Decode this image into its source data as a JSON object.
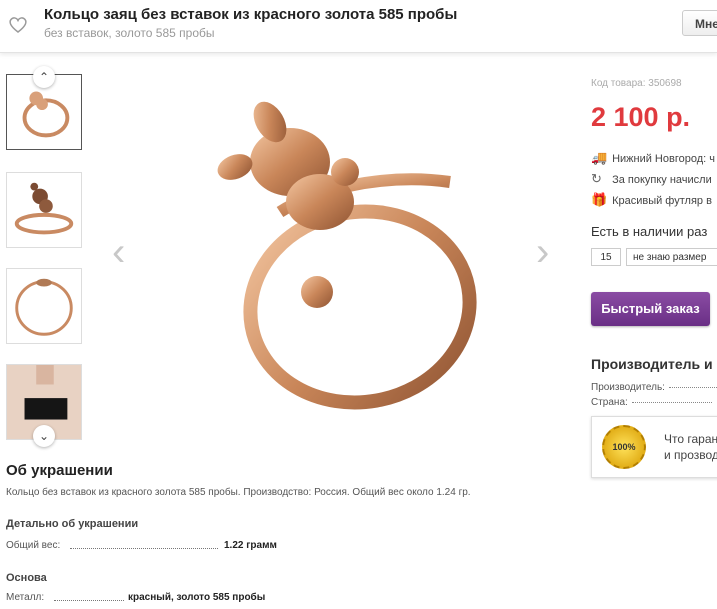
{
  "header": {
    "title": "Кольцо заяц без вставок из красного золота 585 пробы",
    "subtitle": "без вставок, золото 585 пробы",
    "button_label": "Мне",
    "heart_icon": "heart-icon"
  },
  "gallery": {
    "thumbnails": [
      "ring-front",
      "ring-side",
      "ring-top",
      "model-photo"
    ],
    "up_icon": "chevron-up-icon",
    "down_icon": "chevron-down-icon",
    "prev_icon": "chevron-left-icon",
    "next_icon": "chevron-right-icon"
  },
  "product": {
    "sku": "Код товара: 350698",
    "price": "2 100 р.",
    "price_color": "#e03a3e",
    "delivery": "Нижний Новгород: ч",
    "bonus": "За покупку начисли",
    "gift": "Красивый футляр в",
    "stock": "Есть в наличии раз",
    "qty": "15",
    "size_placeholder": "не знаю размер",
    "order_button": "Быстрый заказ",
    "order_color": "#7a3d95"
  },
  "manufacturer": {
    "heading": "Производитель и",
    "rows": [
      {
        "label": "Производитель:"
      },
      {
        "label": "Страна:"
      }
    ],
    "badge": "100%",
    "guarantee_line1": "Что гаран",
    "guarantee_line2": "и прозвод"
  },
  "about": {
    "heading": "Об украшении",
    "text": "Кольцо без вставок из красного золота 585 пробы. Производство: Россия. Общий вес около 1.24 гр.",
    "details_heading": "Детально об украшении",
    "weight_label": "Общий вес:",
    "weight_value": "1.22 грамм",
    "base_heading": "Основа",
    "metal_label": "Металл:",
    "metal_value": "красный, золото 585 пробы"
  }
}
